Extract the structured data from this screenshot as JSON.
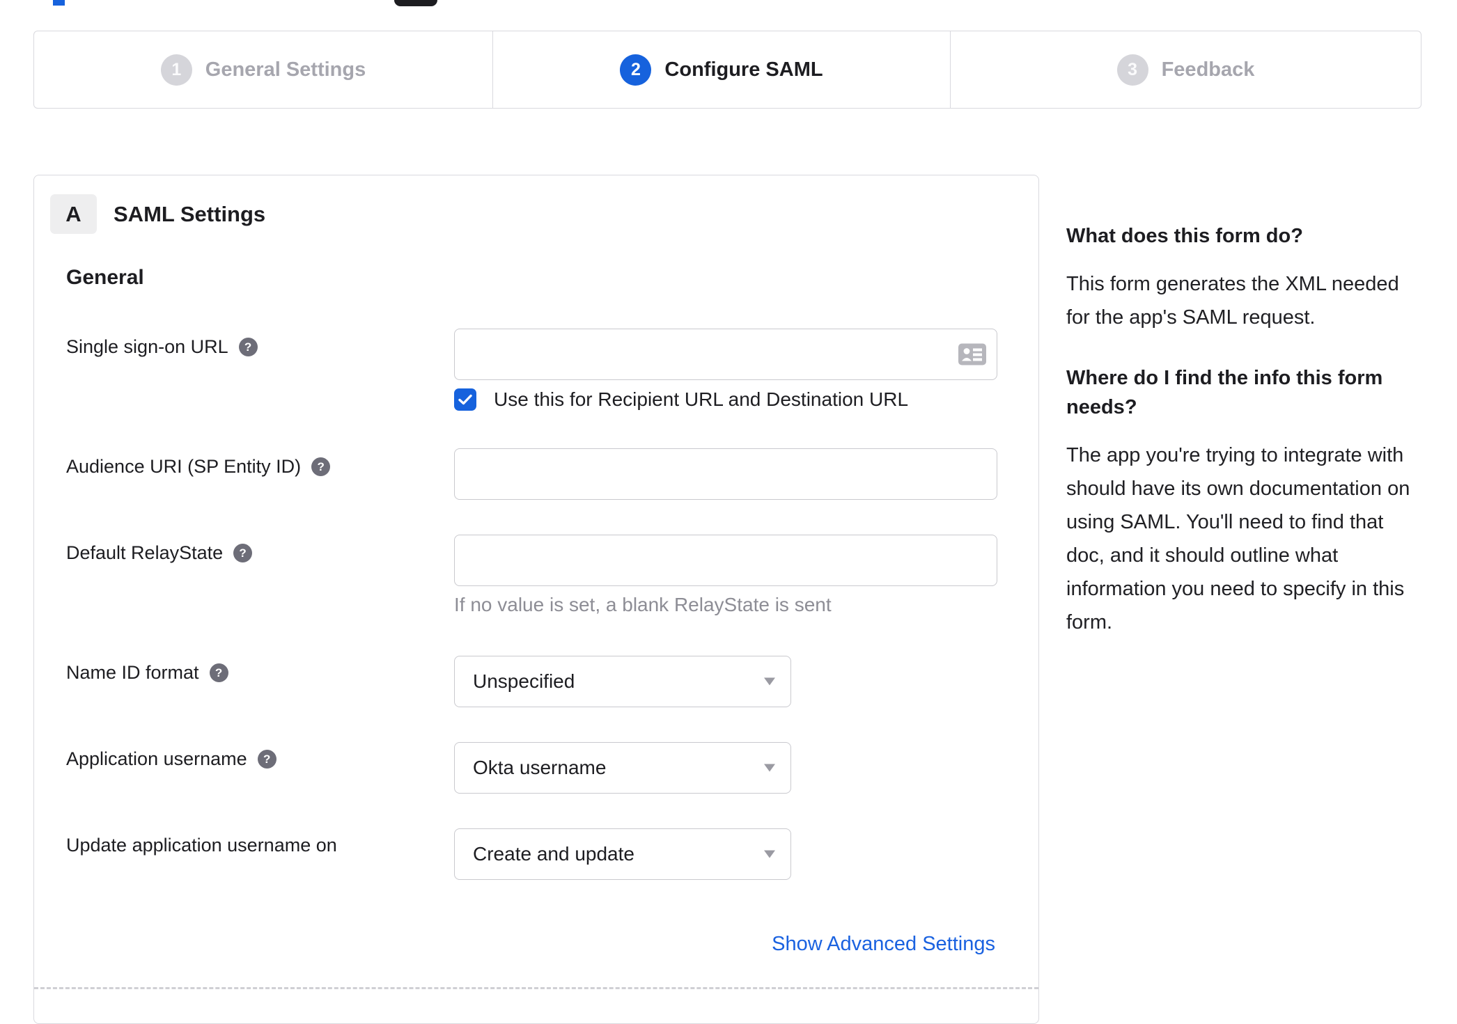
{
  "wizard": {
    "steps": [
      {
        "number": "1",
        "label": "General Settings",
        "state": "inactive"
      },
      {
        "number": "2",
        "label": "Configure SAML",
        "state": "active"
      },
      {
        "number": "3",
        "label": "Feedback",
        "state": "inactive"
      }
    ]
  },
  "panel": {
    "badge": "A",
    "title": "SAML Settings",
    "section": "General",
    "fields": {
      "sso": {
        "label": "Single sign-on URL",
        "value": "",
        "checkbox_label": "Use this for Recipient URL and Destination URL",
        "checked": true
      },
      "audience": {
        "label": "Audience URI (SP Entity ID)",
        "value": ""
      },
      "relay": {
        "label": "Default RelayState",
        "value": "",
        "hint": "If no value is set, a blank RelayState is sent"
      },
      "name_id": {
        "label": "Name ID format",
        "value": "Unspecified"
      },
      "app_username": {
        "label": "Application username",
        "value": "Okta username"
      },
      "update_username": {
        "label": "Update application username on",
        "value": "Create and update"
      }
    },
    "advanced_link": "Show Advanced Settings"
  },
  "sidebar": {
    "heading1": "What does this form do?",
    "para1": "This form generates the XML needed\nfor the app's SAML request.",
    "heading2": "Where do I find the info this form\nneeds?",
    "para2": "The app you're trying to integrate with\nshould have its own documentation on\nusing SAML. You'll need to find that\ndoc, and it should outline what\ninformation you need to specify in this\nform."
  },
  "colors": {
    "accent_blue": "#1662dd",
    "link_blue": "#1a62e0",
    "inactive_gray": "#a6a6ae"
  }
}
